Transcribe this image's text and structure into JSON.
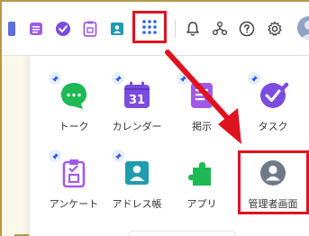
{
  "header": {
    "icons": [
      {
        "name": "calendar-partial-icon"
      },
      {
        "name": "board-icon",
        "color": "#a05be6"
      },
      {
        "name": "task-check-icon",
        "color": "#7a4de0"
      },
      {
        "name": "survey-icon",
        "color": "#a05be6"
      },
      {
        "name": "address-book-icon",
        "color": "#1f9cae"
      },
      {
        "name": "app-launcher-icon"
      },
      {
        "name": "notification-bell-icon"
      },
      {
        "name": "org-chart-icon"
      },
      {
        "name": "help-icon"
      },
      {
        "name": "settings-gear-icon"
      },
      {
        "name": "user-avatar"
      }
    ]
  },
  "apps": [
    {
      "label": "トーク",
      "icon": "talk-icon",
      "color": "#1db954",
      "pinned": true
    },
    {
      "label": "カレンダー",
      "icon": "calendar-icon",
      "color": "#7a4de0",
      "pinned": true,
      "number": "31"
    },
    {
      "label": "掲示",
      "icon": "board-icon",
      "color": "#a05be6",
      "pinned": true
    },
    {
      "label": "タスク",
      "icon": "task-icon",
      "color": "#7a4de0",
      "pinned": true
    },
    {
      "label": "アンケート",
      "icon": "survey-icon",
      "color": "#a05be6",
      "pinned": true
    },
    {
      "label": "アドレス帳",
      "icon": "address-book-icon",
      "color": "#1f9cae",
      "pinned": true
    },
    {
      "label": "アプリ",
      "icon": "apps-puzzle-icon",
      "color": "#1db954",
      "pinned": false
    },
    {
      "label": "管理者画面",
      "icon": "admin-console-icon",
      "color": "#6f7a89",
      "pinned": false
    }
  ],
  "colors": {
    "highlight": "#e0121f",
    "accent": "#2f62e8"
  }
}
